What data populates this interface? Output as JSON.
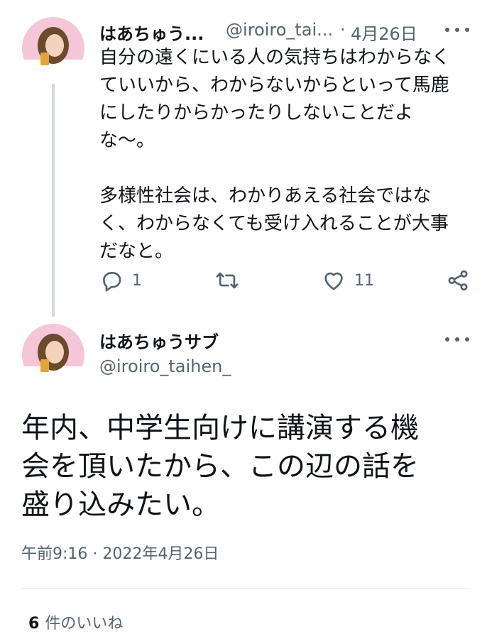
{
  "reply_tweet": {
    "display_name": "はあちゅう...",
    "handle": "@iroiro_tai...",
    "separator": "·",
    "date": "4月26日",
    "text": "自分の遠くにいる人の気持ちはわからなく\nていいから、わからないからといって馬鹿\nにしたりからかったりしないことだよ\nな〜。\n\n多様性社会は、わかりあえる社会ではな\nく、わからなくても受け入れることが大事\nだなと。",
    "reply_count": "1",
    "like_count": "11",
    "icons": [
      "reply-icon",
      "retweet-icon",
      "heart-icon",
      "share-icon",
      "more-icon"
    ]
  },
  "main_tweet": {
    "display_name": "はあちゅうサブ",
    "handle": "@iroiro_taihen_",
    "text": "年内、中学生向けに講演する機\n会を頂いたから、この辺の話を\n盛り込みたい。",
    "timestamp": "午前9:16 · 2022年4月26日",
    "likes_number": "6",
    "likes_label": "件のいいね"
  },
  "colors": {
    "text_primary": "#0f1419",
    "text_secondary": "#536471",
    "thread_line": "#cfd9de",
    "divider": "#e6ecf0"
  }
}
